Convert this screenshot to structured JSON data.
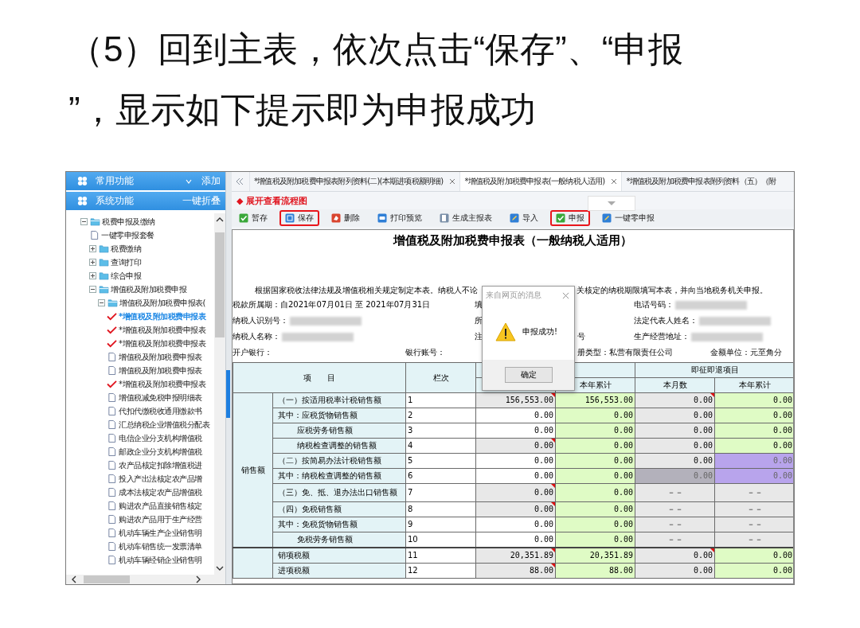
{
  "heading_lines": [
    "（5）回到主表，依次点击“保存”、“申报",
    "”，显示如下提示即为申报成功"
  ],
  "sidebar": {
    "panels": [
      {
        "label": "常用功能",
        "action": "添加",
        "caret": true
      },
      {
        "label": "系统功能",
        "action": "一键折叠",
        "caret": false
      }
    ],
    "tree": [
      {
        "label": "税费申报及缴纳",
        "kind": "folder",
        "expanded": true,
        "selected": false,
        "children": [
          {
            "label": "一键零申报套餐",
            "kind": "doc",
            "checked": false,
            "selected": false
          },
          {
            "label": "税费缴纳",
            "kind": "folder",
            "expanded": false,
            "selected": false
          },
          {
            "label": "查询打印",
            "kind": "folder",
            "expanded": false,
            "selected": false
          },
          {
            "label": "综合申报",
            "kind": "folder",
            "expanded": false,
            "selected": false
          },
          {
            "label": "增值税及附加税费申报",
            "kind": "folder",
            "expanded": true,
            "selected": false,
            "children": [
              {
                "label": "增值税及附加税费申报表(",
                "kind": "folder",
                "expanded": true,
                "selected": false,
                "children": [
                  {
                    "label": "*增值税及附加税费申报表",
                    "kind": "doc",
                    "checked": true,
                    "selected": true
                  },
                  {
                    "label": "*增值税及附加税费申报表",
                    "kind": "doc",
                    "checked": true,
                    "selected": false
                  },
                  {
                    "label": "*增值税及附加税费申报表",
                    "kind": "doc",
                    "checked": true,
                    "selected": false
                  },
                  {
                    "label": "增值税及附加税费申报表",
                    "kind": "doc",
                    "checked": false,
                    "selected": false
                  },
                  {
                    "label": "增值税及附加税费申报表",
                    "kind": "doc",
                    "checked": false,
                    "selected": false
                  },
                  {
                    "label": "*增值税及附加税费申报表",
                    "kind": "doc",
                    "checked": true,
                    "selected": false
                  },
                  {
                    "label": "增值税减免税申报明细表",
                    "kind": "doc",
                    "checked": false,
                    "selected": false
                  },
                  {
                    "label": "代扣代缴税收通用缴款书",
                    "kind": "doc",
                    "checked": false,
                    "selected": false
                  },
                  {
                    "label": "汇总纳税企业增值税分配表",
                    "kind": "doc",
                    "checked": false,
                    "selected": false
                  },
                  {
                    "label": "电信企业分支机构增值税",
                    "kind": "doc",
                    "checked": false,
                    "selected": false
                  },
                  {
                    "label": "邮政企业分支机构增值税",
                    "kind": "doc",
                    "checked": false,
                    "selected": false
                  },
                  {
                    "label": "农产品核定扣除增值税进",
                    "kind": "doc",
                    "checked": false,
                    "selected": false
                  },
                  {
                    "label": "投入产出法核定农产品增",
                    "kind": "doc",
                    "checked": false,
                    "selected": false
                  },
                  {
                    "label": "成本法核定农产品增值税",
                    "kind": "doc",
                    "checked": false,
                    "selected": false
                  },
                  {
                    "label": "购进农产品直接销售核定",
                    "kind": "doc",
                    "checked": false,
                    "selected": false
                  },
                  {
                    "label": "购进农产品用于生产经营",
                    "kind": "doc",
                    "checked": false,
                    "selected": false
                  },
                  {
                    "label": "机动车辆生产企业销售明",
                    "kind": "doc",
                    "checked": false,
                    "selected": false
                  },
                  {
                    "label": "机动车销售统一发票清单",
                    "kind": "doc",
                    "checked": false,
                    "selected": false
                  },
                  {
                    "label": "机动车辆经销企业销售明",
                    "kind": "doc",
                    "checked": false,
                    "selected": false
                  }
                ]
              }
            ]
          }
        ]
      }
    ]
  },
  "tabs": [
    {
      "label": "*增值税及附加税费申报表附列资料(二)(本期进项税额明细)",
      "selected": false,
      "closable": true
    },
    {
      "label": "*增值税及附加税费申报表(一般纳税人适用)",
      "selected": true,
      "closable": true
    },
    {
      "label": "*增值税及附加税费申报表附列资料（五）（附",
      "selected": false,
      "closable": false
    }
  ],
  "flow_link": "◆ 展开查看流程图",
  "toolbar": [
    {
      "label": "暂存",
      "kind": "check",
      "highlighted": false
    },
    {
      "label": "保存",
      "kind": "disk",
      "highlighted": true
    },
    {
      "label": "删除",
      "kind": "eraser",
      "highlighted": false
    },
    {
      "label": "打印预览",
      "kind": "printer",
      "highlighted": false
    },
    {
      "label": "生成主报表",
      "kind": "pages",
      "highlighted": false
    },
    {
      "label": "导入",
      "kind": "pencil",
      "highlighted": false
    },
    {
      "label": "申报",
      "kind": "check",
      "highlighted": true
    },
    {
      "label": "一键零申报",
      "kind": "pencil",
      "highlighted": false
    }
  ],
  "form": {
    "title": "增值税及附加税费申报表（一般纳税人适用）",
    "notice_parts": [
      "根据国家税收法律法规及增值税相关规定制定本表。纳税人不论",
      "关核定的纳税期限填写本表，并向当地税务机关申报。"
    ],
    "info_rows": [
      {
        "col_1": {
          "text": "税款所属期：自2021年07月01日 至 2021年07月31日",
          "blurred": false
        },
        "col_3": {
          "text": "填",
          "blurred": false
        },
        "col_5": {
          "text": "电话号码：",
          "blurred": true
        }
      },
      {
        "col_1": {
          "text": "纳税人识别号：",
          "blurred": true
        },
        "col_3": {
          "text": "所",
          "blurred": false
        },
        "col_5": {
          "text": "法定代表人姓名：",
          "blurred": true
        }
      },
      {
        "col_1": {
          "text": "纳税人名称：",
          "blurred": true
        },
        "col_3": {
          "text": "注",
          "blurred": false
        },
        "col_4": {
          "text": "号",
          "blurred": false
        },
        "col_5": {
          "text": "生产经营地址：",
          "blurred": true
        }
      },
      {
        "col_1": {
          "text": "开户银行：",
          "blurred": false
        },
        "col_2": {
          "text": "银行账号：",
          "blurred": false
        },
        "col_4": {
          "text": "册类型：私营有限责任公司",
          "blurred": false
        },
        "col_5": {
          "text": "金额单位：元至角分",
          "blurred": false
        }
      }
    ],
    "table": {
      "item_head": "项　　目",
      "line_head": "栏次",
      "group_heads": [
        "即征即退项目"
      ],
      "column_heads": [
        "本年累计",
        "本月数",
        "本年累计"
      ],
      "groups": [
        {
          "label": "销售额",
          "rows": [
            {
              "item": "（一）按适用税率计税销售额",
              "indented": false,
              "line": "1",
              "cells": [
                {
                  "text": "156,553.00",
                  "kind": "shaded",
                  "flag": true
                },
                {
                  "text": "156,553.00",
                  "kind": "green",
                  "flag": false
                },
                {
                  "text": "0.00",
                  "kind": "shaded",
                  "flag": true
                },
                {
                  "text": "0.00",
                  "kind": "green",
                  "flag": false
                }
              ]
            },
            {
              "item": "其中：应税货物销售额",
              "indented": false,
              "line": "2",
              "cells": [
                {
                  "text": "0.00",
                  "kind": "plain",
                  "flag": false
                },
                {
                  "text": "0.00",
                  "kind": "green",
                  "flag": false
                },
                {
                  "text": "0.00",
                  "kind": "shaded",
                  "flag": false
                },
                {
                  "text": "0.00",
                  "kind": "green",
                  "flag": false
                }
              ]
            },
            {
              "item": "应税劳务销售额",
              "indented": true,
              "line": "3",
              "cells": [
                {
                  "text": "0.00",
                  "kind": "plain",
                  "flag": false
                },
                {
                  "text": "0.00",
                  "kind": "green",
                  "flag": false
                },
                {
                  "text": "0.00",
                  "kind": "shaded",
                  "flag": false
                },
                {
                  "text": "0.00",
                  "kind": "green",
                  "flag": false
                }
              ]
            },
            {
              "item": "纳税检查调整的销售额",
              "indented": true,
              "line": "4",
              "cells": [
                {
                  "text": "0.00",
                  "kind": "shaded",
                  "flag": true
                },
                {
                  "text": "0.00",
                  "kind": "green",
                  "flag": false
                },
                {
                  "text": "0.00",
                  "kind": "shaded",
                  "flag": false
                },
                {
                  "text": "0.00",
                  "kind": "green",
                  "flag": false
                }
              ]
            },
            {
              "item": "（二）按简易办法计税销售额",
              "indented": false,
              "line": "5",
              "cells": [
                {
                  "text": "0.00",
                  "kind": "plain",
                  "flag": false
                },
                {
                  "text": "0.00",
                  "kind": "green",
                  "flag": false
                },
                {
                  "text": "0.00",
                  "kind": "shaded",
                  "flag": false
                },
                {
                  "text": "0.00",
                  "kind": "purple",
                  "flag": false
                }
              ]
            },
            {
              "item": "其中：纳税检查调整的销售额",
              "indented": false,
              "line": "6",
              "cells": [
                {
                  "text": "0.00",
                  "kind": "plain",
                  "flag": false
                },
                {
                  "text": "0.00",
                  "kind": "green",
                  "flag": false
                },
                {
                  "text": "0.00",
                  "kind": "dim",
                  "flag": false
                },
                {
                  "text": "0.00",
                  "kind": "purple",
                  "flag": false
                }
              ]
            },
            {
              "item": "（三）免、抵、退办法出口销售额",
              "indented": false,
              "line": "7",
              "cells": [
                {
                  "text": "0.00",
                  "kind": "shaded",
                  "flag": true
                },
                {
                  "text": "0.00",
                  "kind": "green",
                  "flag": false
                },
                {
                  "text": "－－",
                  "kind": "na",
                  "flag": false
                },
                {
                  "text": "－－",
                  "kind": "na",
                  "flag": false
                }
              ]
            },
            {
              "item": "（四）免税销售额",
              "indented": false,
              "line": "8",
              "cells": [
                {
                  "text": "0.00",
                  "kind": "shaded",
                  "flag": true
                },
                {
                  "text": "0.00",
                  "kind": "green",
                  "flag": false
                },
                {
                  "text": "－－",
                  "kind": "na",
                  "flag": false
                },
                {
                  "text": "－－",
                  "kind": "na",
                  "flag": false
                }
              ]
            },
            {
              "item": "其中：免税货物销售额",
              "indented": false,
              "line": "9",
              "cells": [
                {
                  "text": "0.00",
                  "kind": "plain",
                  "flag": false
                },
                {
                  "text": "0.00",
                  "kind": "green",
                  "flag": false
                },
                {
                  "text": "－－",
                  "kind": "na",
                  "flag": false
                },
                {
                  "text": "－－",
                  "kind": "na",
                  "flag": false
                }
              ]
            },
            {
              "item": "免税劳务销售额",
              "indented": true,
              "line": "10",
              "cells": [
                {
                  "text": "0.00",
                  "kind": "plain",
                  "flag": false
                },
                {
                  "text": "0.00",
                  "kind": "green",
                  "flag": false
                },
                {
                  "text": "－－",
                  "kind": "na",
                  "flag": false
                },
                {
                  "text": "－－",
                  "kind": "na",
                  "flag": false
                }
              ]
            }
          ]
        },
        {
          "rows": [
            {
              "item": "销项税额",
              "indented": false,
              "line": "11",
              "cells": [
                {
                  "text": "20,351.89",
                  "kind": "shaded",
                  "flag": true
                },
                {
                  "text": "20,351.89",
                  "kind": "green",
                  "flag": false
                },
                {
                  "text": "0.00",
                  "kind": "shaded",
                  "flag": true
                },
                {
                  "text": "0.00",
                  "kind": "green",
                  "flag": false
                }
              ]
            },
            {
              "item": "进项税额",
              "indented": false,
              "line": "12",
              "cells": [
                {
                  "text": "88.00",
                  "kind": "shaded",
                  "flag": true
                },
                {
                  "text": "88.00",
                  "kind": "green",
                  "flag": false
                },
                {
                  "text": "0.00",
                  "kind": "shaded",
                  "flag": false
                },
                {
                  "text": "0.00",
                  "kind": "green",
                  "flag": false
                }
              ]
            }
          ]
        }
      ]
    }
  },
  "dialog": {
    "title": "来自网页的消息",
    "message": "申报成功!",
    "button": "确定"
  }
}
